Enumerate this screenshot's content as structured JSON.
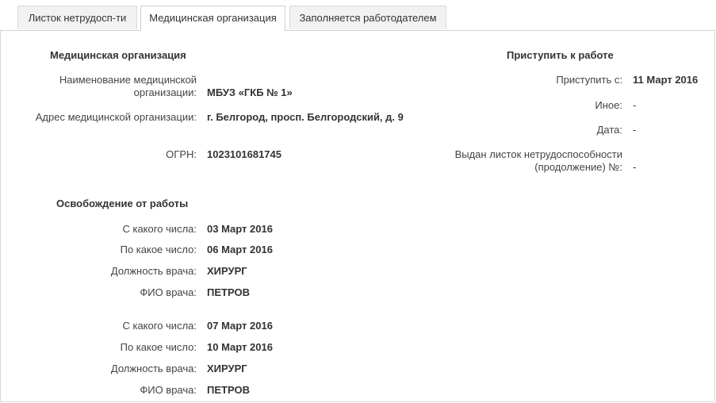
{
  "tabs": [
    {
      "label": "Листок нетрудосп-ти"
    },
    {
      "label": "Медицинская организация"
    },
    {
      "label": "Заполняется работодателем"
    }
  ],
  "org": {
    "heading": "Медицинская организация",
    "name_label": "Наименование медицинской организации:",
    "name_value": "МБУЗ «ГКБ № 1»",
    "address_label": "Адрес медицинской организации:",
    "address_value": "г. Белгород, просп. Белгородский, д. 9",
    "ogrn_label": "ОГРН:",
    "ogrn_value": "1023101681745"
  },
  "release": {
    "heading": "Освобождение от работы",
    "periods": [
      {
        "from_label": "С какого числа:",
        "from": "03 Март 2016",
        "to_label": "По какое число:",
        "to": "06 Март 2016",
        "position_label": "Должность врача:",
        "position": "ХИРУРГ",
        "doctor_label": "ФИО врача:",
        "doctor": "ПЕТРОВ"
      },
      {
        "from_label": "С какого числа:",
        "from": "07 Март 2016",
        "to_label": "По какое число:",
        "to": "10 Март 2016",
        "position_label": "Должность врача:",
        "position": "ХИРУРГ",
        "doctor_label": "ФИО врача:",
        "doctor": "ПЕТРОВ"
      }
    ]
  },
  "work": {
    "heading": "Приступить к работе",
    "start_label": "Приступить с:",
    "start_value": "11 Март 2016",
    "other_label": "Иное:",
    "other_value": "-",
    "date_label": "Дата:",
    "date_value": "-",
    "continuation_label": "Выдан листок нетрудоспособности (продолжение) №:",
    "continuation_value": "-"
  }
}
